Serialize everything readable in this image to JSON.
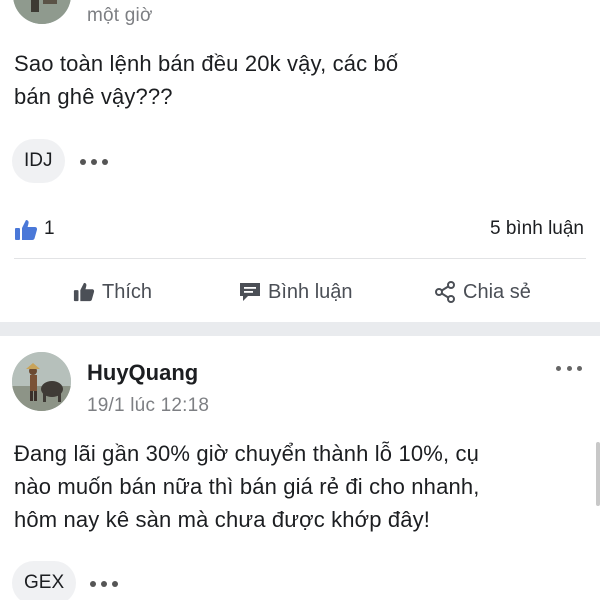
{
  "post1": {
    "time": "một giờ",
    "text_lines": [
      "Sao toàn lệnh bán đều 20k vậy, các bố",
      "bán ghê vậy???"
    ],
    "tag": "IDJ",
    "like_count": "1",
    "comment_count": "5 bình luận",
    "actions": {
      "like": "Thích",
      "comment": "Bình luận",
      "share": "Chia sẻ"
    }
  },
  "post2": {
    "author": "HuyQuang",
    "time": "19/1 lúc 12:18",
    "text_lines": [
      "Đang lãi gần 30% giờ chuyển thành lỗ 10%, cụ",
      "nào muốn bán nữa thì bán giá rẻ đi cho nhanh,",
      "hôm nay kê sàn mà chưa được khớp đây!"
    ],
    "tag": "GEX"
  },
  "colors": {
    "like_blue": "#4a78d8",
    "separator": "#e9ebee",
    "secondary_text": "#7d7f83",
    "action_text": "#4b4f56"
  },
  "icons": {
    "like_badge": "thumbs-up-icon",
    "like_action": "thumbs-up-icon",
    "comment_action": "comment-bubble-icon",
    "share_action": "share-icon",
    "more": "more-dots-icon"
  }
}
